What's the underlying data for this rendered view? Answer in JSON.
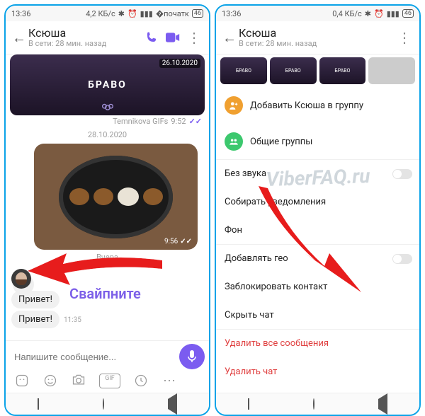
{
  "left": {
    "status": {
      "time": "13:36",
      "net": "4,2 КБ/с",
      "badge": "46"
    },
    "header": {
      "name": "Ксюша",
      "sub": "В сети: 28 мин. назад"
    },
    "share": {
      "date": "26.10.2020",
      "title": "БРАВО"
    },
    "cap": {
      "src": "Temnikova GIFs",
      "time": "9:52"
    },
    "date2": "28.10.2020",
    "photo_time": "9:56",
    "date3": "Вчера",
    "msg": [
      "Привет!",
      "Привет!"
    ],
    "msg_time": "11:35",
    "input_ph": "Напишите сообщение...",
    "toolbar_gif": "GIF"
  },
  "right": {
    "status": {
      "time": "13:36",
      "net": "0,4 КБ/с",
      "badge": "46"
    },
    "header": {
      "name": "Ксюша",
      "sub": "В сети: 28 мин. назад"
    },
    "thumb_text": "БРАВО",
    "menu": {
      "add": "Добавить Ксюша в группу",
      "groups": "Общие группы",
      "mute": "Без звука",
      "notif": "Собирать уведомления",
      "bg": "Фон",
      "geo": "Добавлять гео",
      "block": "Заблокировать контакт",
      "hide": "Скрыть чат",
      "del_msgs": "Удалить все сообщения",
      "del_chat": "Удалить чат"
    }
  },
  "annot": {
    "swipe": "Свайпните"
  },
  "watermark": "ViberFAQ.ru"
}
